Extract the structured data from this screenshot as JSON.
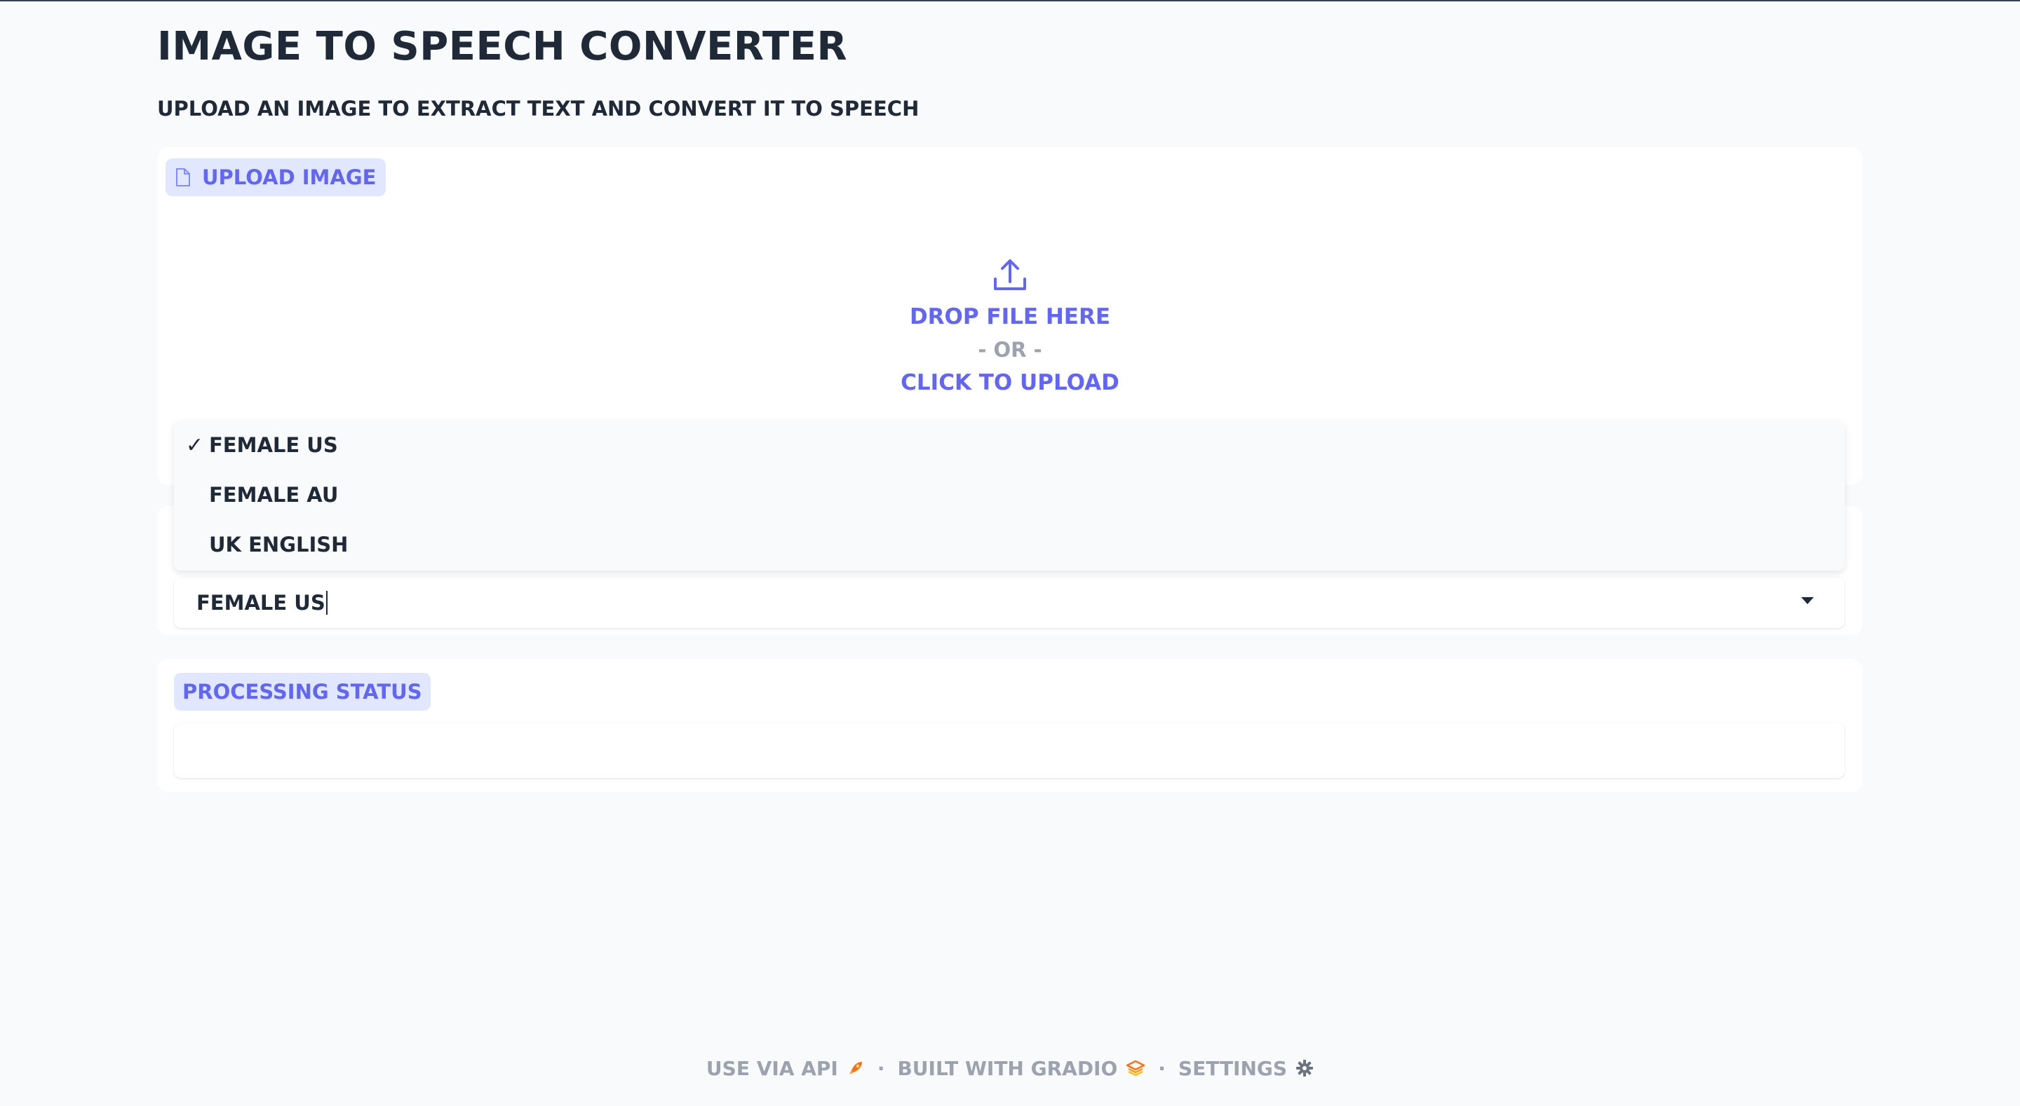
{
  "header": {
    "title": "IMAGE TO SPEECH CONVERTER",
    "subtitle": "UPLOAD AN IMAGE TO EXTRACT TEXT AND CONVERT IT TO SPEECH"
  },
  "upload": {
    "label": "UPLOAD IMAGE",
    "label_icon": "file-icon",
    "drop_text": "DROP FILE HERE",
    "or_text": "- OR -",
    "click_text": "CLICK TO UPLOAD",
    "upload_icon": "upload-icon"
  },
  "voice": {
    "selected": "FEMALE US",
    "options": [
      {
        "label": "FEMALE US",
        "selected": true,
        "check": "✓"
      },
      {
        "label": "FEMALE AU",
        "selected": false,
        "check": ""
      },
      {
        "label": "UK ENGLISH",
        "selected": false,
        "check": ""
      }
    ]
  },
  "status": {
    "label": "PROCESSING STATUS",
    "value": ""
  },
  "footer": {
    "api": "USE VIA API",
    "api_icon": "rocket-icon",
    "separator": "·",
    "built_with": "BUILT WITH GRADIO",
    "gradio_icon": "gradio-logo-icon",
    "settings": "SETTINGS",
    "settings_icon": "gear-icon"
  },
  "colors": {
    "accent": "#6366f1",
    "label_bg": "#e0e7ff",
    "page_bg": "#f8fafc",
    "text": "#1f2937",
    "muted": "#9ca3af"
  }
}
